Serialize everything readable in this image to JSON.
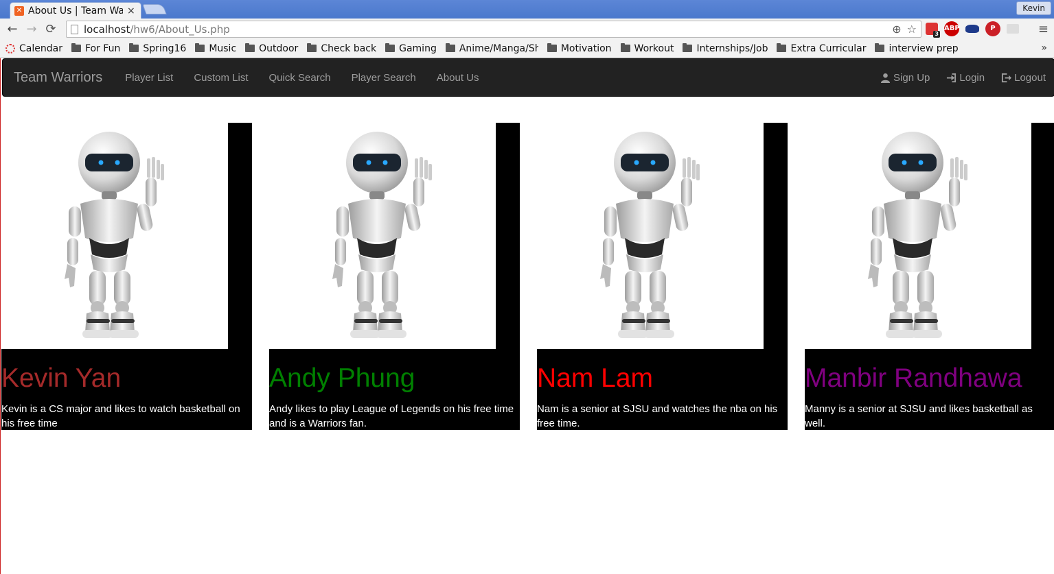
{
  "browser": {
    "tab_title": "About Us | Team Warriors",
    "user": "Kevin",
    "url_host": "localhost",
    "url_path": "/hw6/About_Us.php",
    "bookmarks": [
      "Calendar",
      "For Fun",
      "Spring16",
      "Music",
      "Outdoor",
      "Check back",
      "Gaming",
      "Anime/Manga/Sh",
      "Motivation",
      "Workout",
      "Internships/Job",
      "Extra Curricular",
      "interview prep"
    ],
    "ext_badge": "3",
    "abp_label": "ABP"
  },
  "navbar": {
    "brand": "Team Warriors",
    "links": [
      "Player List",
      "Custom List",
      "Quick Search",
      "Player Search",
      "About Us"
    ],
    "right_links": [
      "Sign Up",
      "Login",
      "Logout"
    ]
  },
  "members": [
    {
      "name": "Kevin Yan",
      "color": "#a52a2a",
      "bio": "Kevin is a CS major and likes to watch basketball on his free time"
    },
    {
      "name": "Andy Phung",
      "color": "#008000",
      "bio": "Andy likes to play League of Legends on his free time and is a Warriors fan."
    },
    {
      "name": "Nam Lam",
      "color": "#ff0000",
      "bio": "Nam is a senior at SJSU and watches the nba on his free time."
    },
    {
      "name": "Manbir Randhawa",
      "color": "#800080",
      "bio": "Manny is a senior at SJSU and likes basketball as well."
    }
  ]
}
